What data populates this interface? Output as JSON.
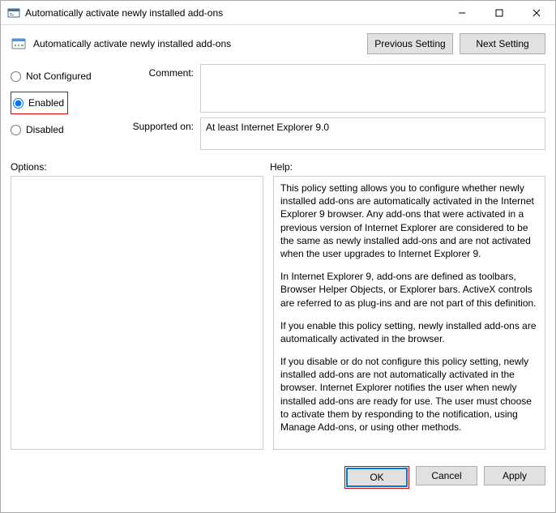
{
  "window": {
    "title": "Automatically activate newly installed add-ons"
  },
  "header": {
    "policy_title": "Automatically activate newly installed add-ons",
    "prev_btn": "Previous Setting",
    "next_btn": "Next Setting"
  },
  "state": {
    "not_configured": "Not Configured",
    "enabled": "Enabled",
    "disabled": "Disabled"
  },
  "fields": {
    "comment_label": "Comment:",
    "comment_value": "",
    "supported_label": "Supported on:",
    "supported_value": "At least Internet Explorer 9.0"
  },
  "labels": {
    "options": "Options:",
    "help": "Help:"
  },
  "help": {
    "p1": "This policy setting allows you to configure whether newly installed add-ons are automatically activated in the Internet Explorer 9 browser. Any add-ons that were activated in a previous version of Internet Explorer are considered to be the same as newly installed add-ons and are not activated when the user upgrades to Internet Explorer 9.",
    "p2": "In Internet Explorer 9, add-ons are defined as toolbars, Browser Helper Objects, or Explorer bars. ActiveX controls are referred to as plug-ins and are not part of this definition.",
    "p3": "If you enable this policy setting, newly installed add-ons are automatically activated in the browser.",
    "p4": "If you disable or do not configure this policy setting, newly installed add-ons are not automatically activated in the browser. Internet Explorer notifies the user when newly installed add-ons are ready for use. The user must choose to activate them by responding to the notification, using Manage Add-ons, or using other methods."
  },
  "footer": {
    "ok": "OK",
    "cancel": "Cancel",
    "apply": "Apply"
  }
}
